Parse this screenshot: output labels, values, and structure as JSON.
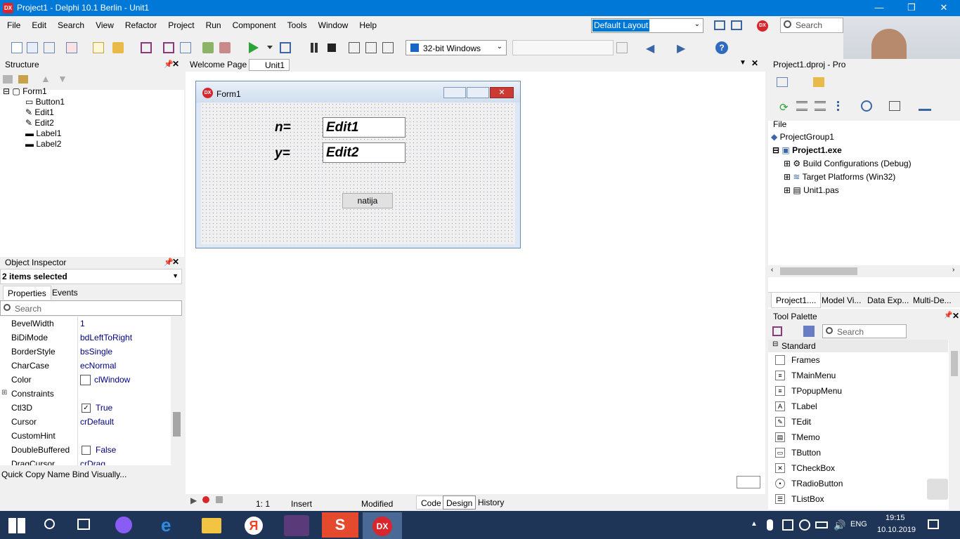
{
  "window": {
    "title": "Project1 - Delphi 10.1 Berlin - Unit1",
    "logo": "DX"
  },
  "menu": [
    "File",
    "Edit",
    "Search",
    "View",
    "Refactor",
    "Project",
    "Run",
    "Component",
    "Tools",
    "Window",
    "Help"
  ],
  "layout": {
    "value": "Default Layout"
  },
  "search_top": {
    "placeholder": "Search"
  },
  "toolbar": {
    "platform": "32-bit Windows"
  },
  "structure": {
    "title": "Structure",
    "tree": [
      {
        "label": "Form1",
        "level": 0
      },
      {
        "label": "Button1",
        "level": 1
      },
      {
        "label": "Edit1",
        "level": 1
      },
      {
        "label": "Edit2",
        "level": 1
      },
      {
        "label": "Label1",
        "level": 1
      },
      {
        "label": "Label2",
        "level": 1
      }
    ]
  },
  "editor_tabs": [
    "Welcome Page",
    "Unit1"
  ],
  "form": {
    "caption": "Form1",
    "label_n": "n=",
    "label_y": "y=",
    "edit1": "Edit1",
    "edit2": "Edit2",
    "button": "natija"
  },
  "object_inspector": {
    "title": "Object Inspector",
    "selection": "2 items selected",
    "tabs": [
      "Properties",
      "Events"
    ],
    "search_placeholder": "Search",
    "properties": [
      {
        "name": "BevelWidth",
        "value": "1"
      },
      {
        "name": "BiDiMode",
        "value": "bdLeftToRight"
      },
      {
        "name": "BorderStyle",
        "value": "bsSingle"
      },
      {
        "name": "CharCase",
        "value": "ecNormal"
      },
      {
        "name": "Color",
        "value": "clWindow"
      },
      {
        "name": "Constraints",
        "value": ""
      },
      {
        "name": "Ctl3D",
        "value": "True"
      },
      {
        "name": "Cursor",
        "value": "crDefault"
      },
      {
        "name": "CustomHint",
        "value": ""
      },
      {
        "name": "DoubleBuffered",
        "value": "False"
      },
      {
        "name": "DragCursor",
        "value": "crDrag"
      }
    ],
    "footer": "Quick Copy Name  Bind Visually..."
  },
  "project": {
    "title": "Project1.dproj - Pro",
    "file_label": "File",
    "group": "ProjectGroup1",
    "exe": "Project1.exe",
    "children": [
      "Build Configurations (Debug)",
      "Target Platforms (Win32)",
      "Unit1.pas"
    ],
    "tabs": [
      "Project1....",
      "Model Vi...",
      "Data Exp...",
      "Multi-De..."
    ]
  },
  "palette": {
    "title": "Tool Palette",
    "search_placeholder": "Search",
    "category": "Standard",
    "items": [
      "Frames",
      "TMainMenu",
      "TPopupMenu",
      "TLabel",
      "TEdit",
      "TMemo",
      "TButton",
      "TCheckBox",
      "TRadioButton",
      "TListBox"
    ]
  },
  "status": {
    "pos": "1:   1",
    "mode": "Insert",
    "modified": "Modified",
    "tabs": [
      "Code",
      "Design",
      "History"
    ]
  },
  "taskbar": {
    "lang": "ENG",
    "time": "19:15",
    "date": "10.10.2019"
  }
}
